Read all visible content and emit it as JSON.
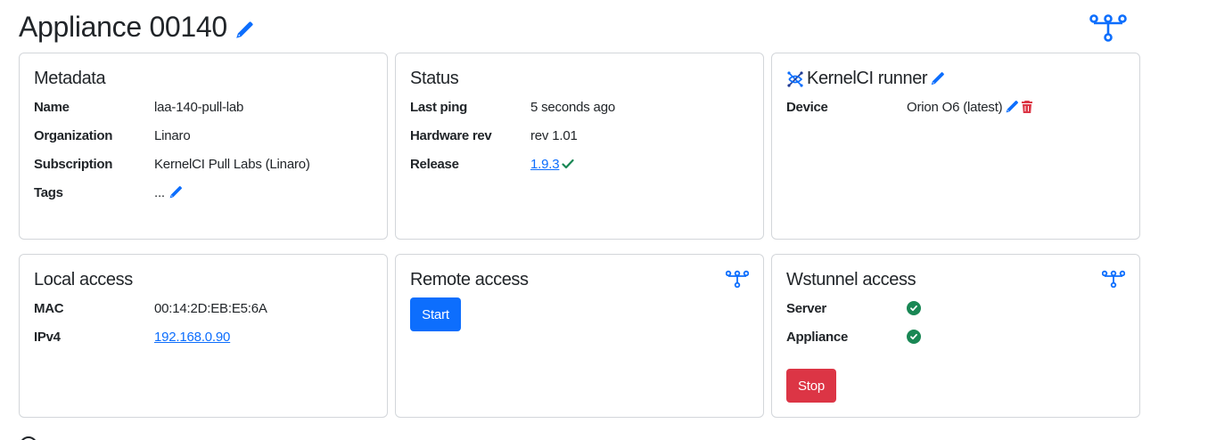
{
  "page": {
    "title": "Appliance 00140",
    "title_edit_icon": "pencil-icon",
    "network_icon": "network-icon"
  },
  "metadata": {
    "title": "Metadata",
    "rows": [
      {
        "label": "Name",
        "value": "laa-140-pull-lab"
      },
      {
        "label": "Organization",
        "value": "Linaro"
      },
      {
        "label": "Subscription",
        "value": "KernelCI Pull Labs (Linaro)"
      },
      {
        "label": "Tags",
        "value": "..."
      }
    ]
  },
  "status": {
    "title": "Status",
    "rows": [
      {
        "label": "Last ping",
        "value": "5 seconds ago"
      },
      {
        "label": "Hardware rev",
        "value": "rev 1.01"
      },
      {
        "label": "Release",
        "value": "1.9.3"
      }
    ]
  },
  "runner": {
    "title": "KernelCI runner",
    "logo_icon": "kernelci-logo-icon",
    "device_label": "Device",
    "device_value": "Orion O6 (latest)"
  },
  "local_access": {
    "title": "Local access",
    "rows": [
      {
        "label": "MAC",
        "value": "00:14:2D:EB:E5:6A"
      },
      {
        "label": "IPv4",
        "value": "192.168.0.90"
      }
    ]
  },
  "remote_access": {
    "title": "Remote access",
    "start_label": "Start"
  },
  "wstunnel": {
    "title": "Wstunnel access",
    "rows": [
      {
        "label": "Server"
      },
      {
        "label": "Appliance"
      }
    ],
    "stop_label": "Stop"
  },
  "colors": {
    "accent": "#0d6efd",
    "danger": "#dc3545",
    "success": "#198754",
    "border": "#d3d6da"
  }
}
